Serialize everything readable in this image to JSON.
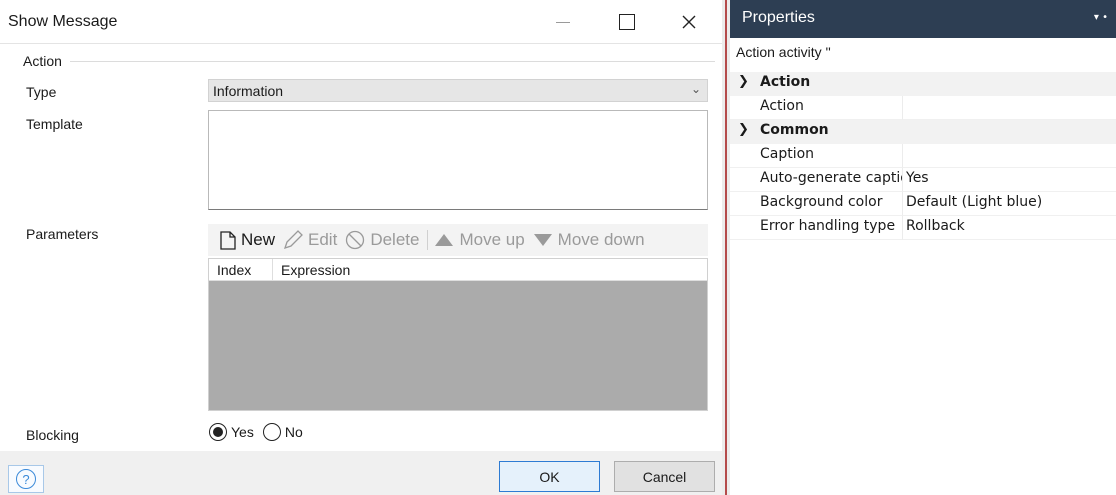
{
  "dialog": {
    "title": "Show Message",
    "group_label": "Action",
    "type": {
      "label": "Type",
      "value": "Information"
    },
    "template": {
      "label": "Template",
      "value": ""
    },
    "parameters": {
      "label": "Parameters",
      "toolbar": {
        "new": "New",
        "edit": "Edit",
        "delete": "Delete",
        "move_up": "Move up",
        "move_down": "Move down"
      },
      "columns": [
        "Index",
        "Expression"
      ]
    },
    "blocking": {
      "label": "Blocking",
      "options": [
        "Yes",
        "No"
      ],
      "selected": "Yes"
    },
    "buttons": {
      "ok": "OK",
      "cancel": "Cancel"
    }
  },
  "properties": {
    "title": "Properties",
    "subtitle": "Action activity ''",
    "categories": [
      {
        "name": "Action",
        "rows": [
          {
            "name": "Action",
            "value": ""
          }
        ]
      },
      {
        "name": "Common",
        "rows": [
          {
            "name": "Caption",
            "value": ""
          },
          {
            "name": "Auto-generate caption",
            "value": "Yes"
          },
          {
            "name": "Background color",
            "value": "Default (Light blue)"
          },
          {
            "name": "Error handling type",
            "value": "Rollback"
          }
        ]
      }
    ]
  },
  "colors": {
    "panel_header": "#2d3e53",
    "splitter": "#b44b4b",
    "accent": "#2d7bd3"
  },
  "icons": {
    "new": "new-document-icon",
    "edit": "pencil-icon",
    "delete": "prohibited-icon",
    "move_up": "triangle-up-icon",
    "move_down": "triangle-down-icon",
    "help": "question-circle-icon"
  }
}
